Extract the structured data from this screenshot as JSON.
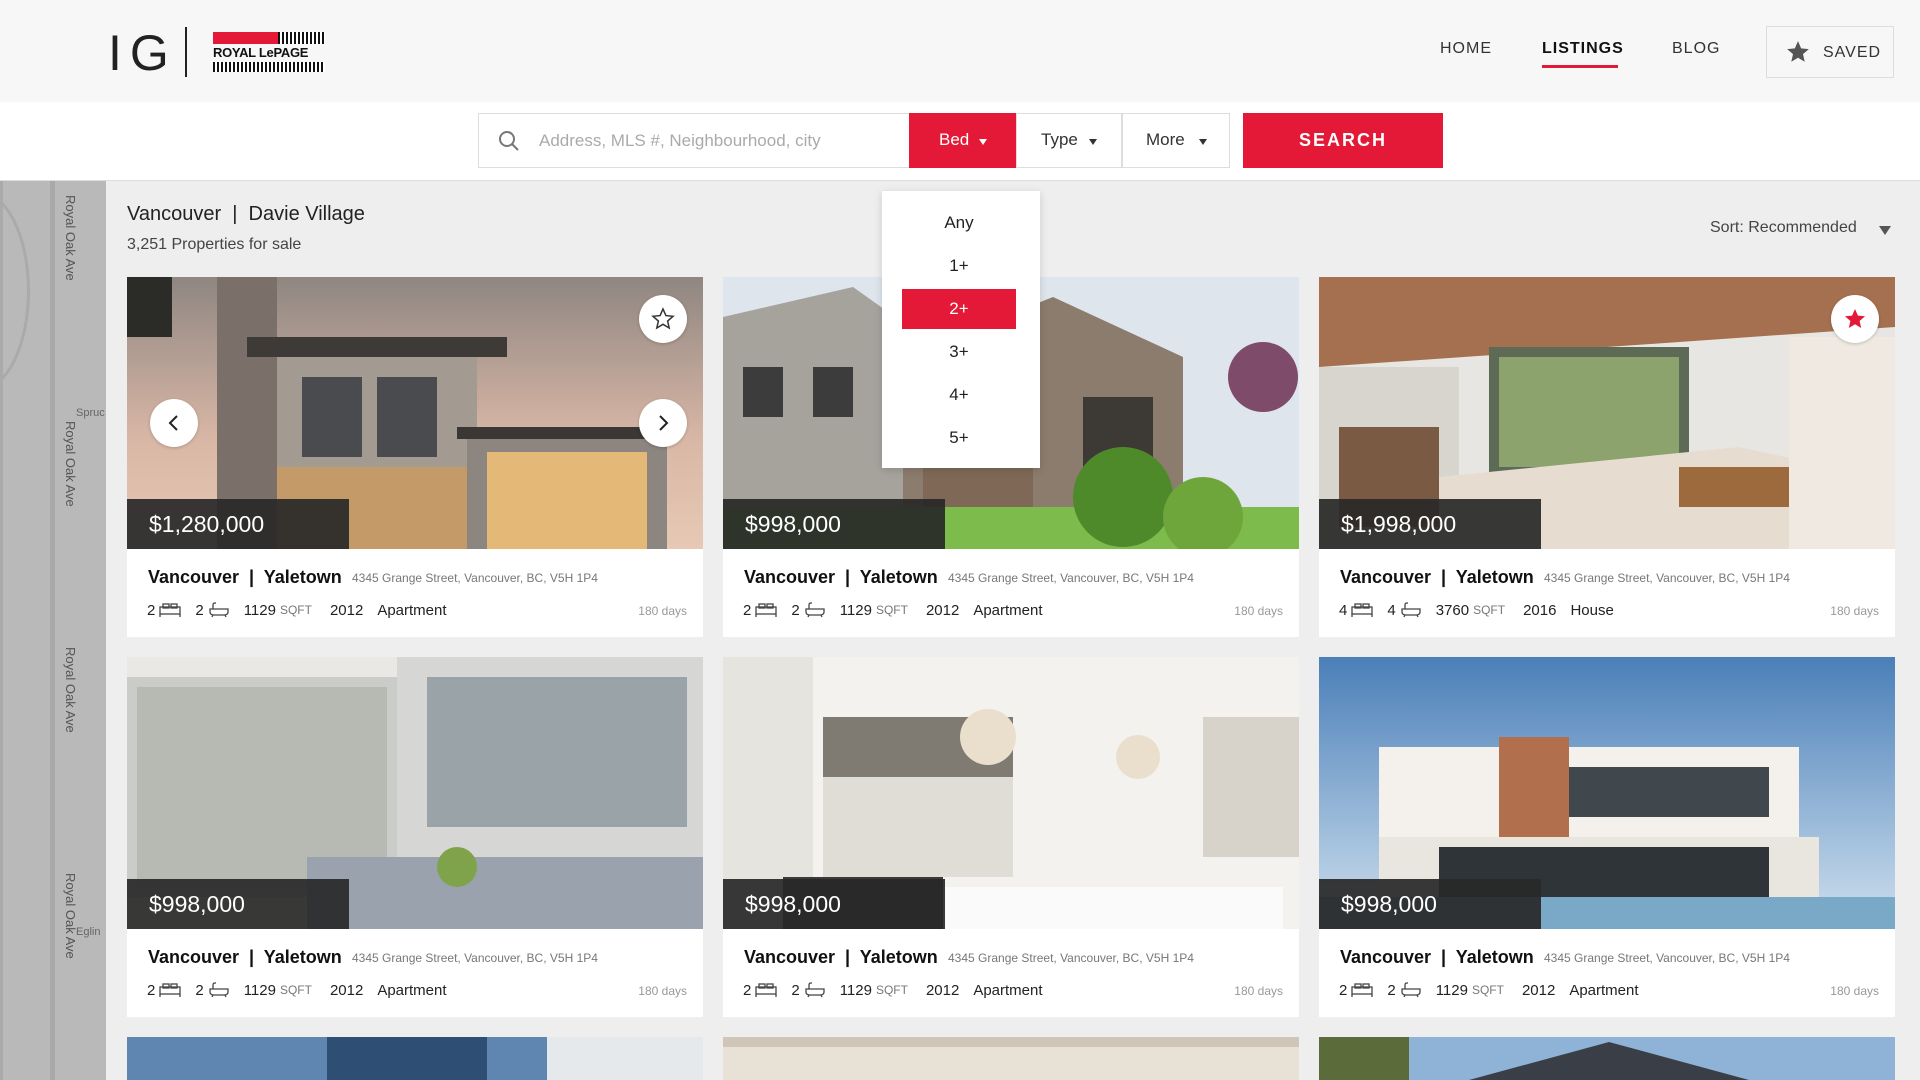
{
  "brand": {
    "initials": "IG",
    "partner": "ROYAL LePAGE"
  },
  "nav": {
    "home": "HOME",
    "listings": "LISTINGS",
    "blog": "BLOG",
    "saved": "SAVED"
  },
  "search": {
    "placeholder": "Address, MLS #, Neighbourhood, city",
    "value": "",
    "bed_label": "Bed",
    "type_label": "Type",
    "more_label": "More",
    "button": "SEARCH"
  },
  "bed_dropdown": {
    "options": [
      "Any",
      "1+",
      "2+",
      "3+",
      "4+",
      "5+"
    ],
    "selected": "2+"
  },
  "map": {
    "streets": [
      "Royal Oak Ave",
      "Royal Oak Ave",
      "Royal Oak Ave",
      "Royal Oak Ave"
    ],
    "labels": [
      "Spruc",
      "Eglin"
    ]
  },
  "results": {
    "title": "Vancouver  |  Davie Village",
    "count": "3,251 Properties for sale",
    "sort": "Sort: Recommended"
  },
  "listings": [
    {
      "price": "$1,280,000",
      "location": "Vancouver  |  Yaletown",
      "address": "4345 Grange Street, Vancouver, BC, V5H 1P4",
      "beds": "2",
      "baths": "2",
      "sqft": "1129",
      "sqft_unit": "SQFT",
      "year": "2012",
      "type": "Apartment",
      "days": "180 days",
      "saved": false
    },
    {
      "price": "$998,000",
      "location": "Vancouver  |  Yaletown",
      "address": "4345 Grange Street, Vancouver, BC, V5H 1P4",
      "beds": "2",
      "baths": "2",
      "sqft": "1129",
      "sqft_unit": "SQFT",
      "year": "2012",
      "type": "Apartment",
      "days": "180 days",
      "saved": false
    },
    {
      "price": "$1,998,000",
      "location": "Vancouver  |  Yaletown",
      "address": "4345 Grange Street, Vancouver, BC, V5H 1P4",
      "beds": "4",
      "baths": "4",
      "sqft": "3760",
      "sqft_unit": "SQFT",
      "year": "2016",
      "type": "House",
      "days": "180 days",
      "saved": true
    },
    {
      "price": "$998,000",
      "location": "Vancouver  |  Yaletown",
      "address": "4345 Grange Street, Vancouver, BC, V5H 1P4",
      "beds": "2",
      "baths": "2",
      "sqft": "1129",
      "sqft_unit": "SQFT",
      "year": "2012",
      "type": "Apartment",
      "days": "180 days",
      "saved": false
    },
    {
      "price": "$998,000",
      "location": "Vancouver  |  Yaletown",
      "address": "4345 Grange Street, Vancouver, BC, V5H 1P4",
      "beds": "2",
      "baths": "2",
      "sqft": "1129",
      "sqft_unit": "SQFT",
      "year": "2012",
      "type": "Apartment",
      "days": "180 days",
      "saved": false
    },
    {
      "price": "$998,000",
      "location": "Vancouver  |  Yaletown",
      "address": "4345 Grange Street, Vancouver, BC, V5H 1P4",
      "beds": "2",
      "baths": "2",
      "sqft": "1129",
      "sqft_unit": "SQFT",
      "year": "2012",
      "type": "Apartment",
      "days": "180 days",
      "saved": false
    }
  ],
  "colors": {
    "accent": "#e31937",
    "price_bg": "#2b2b2b",
    "map": "#b9b9b9"
  }
}
